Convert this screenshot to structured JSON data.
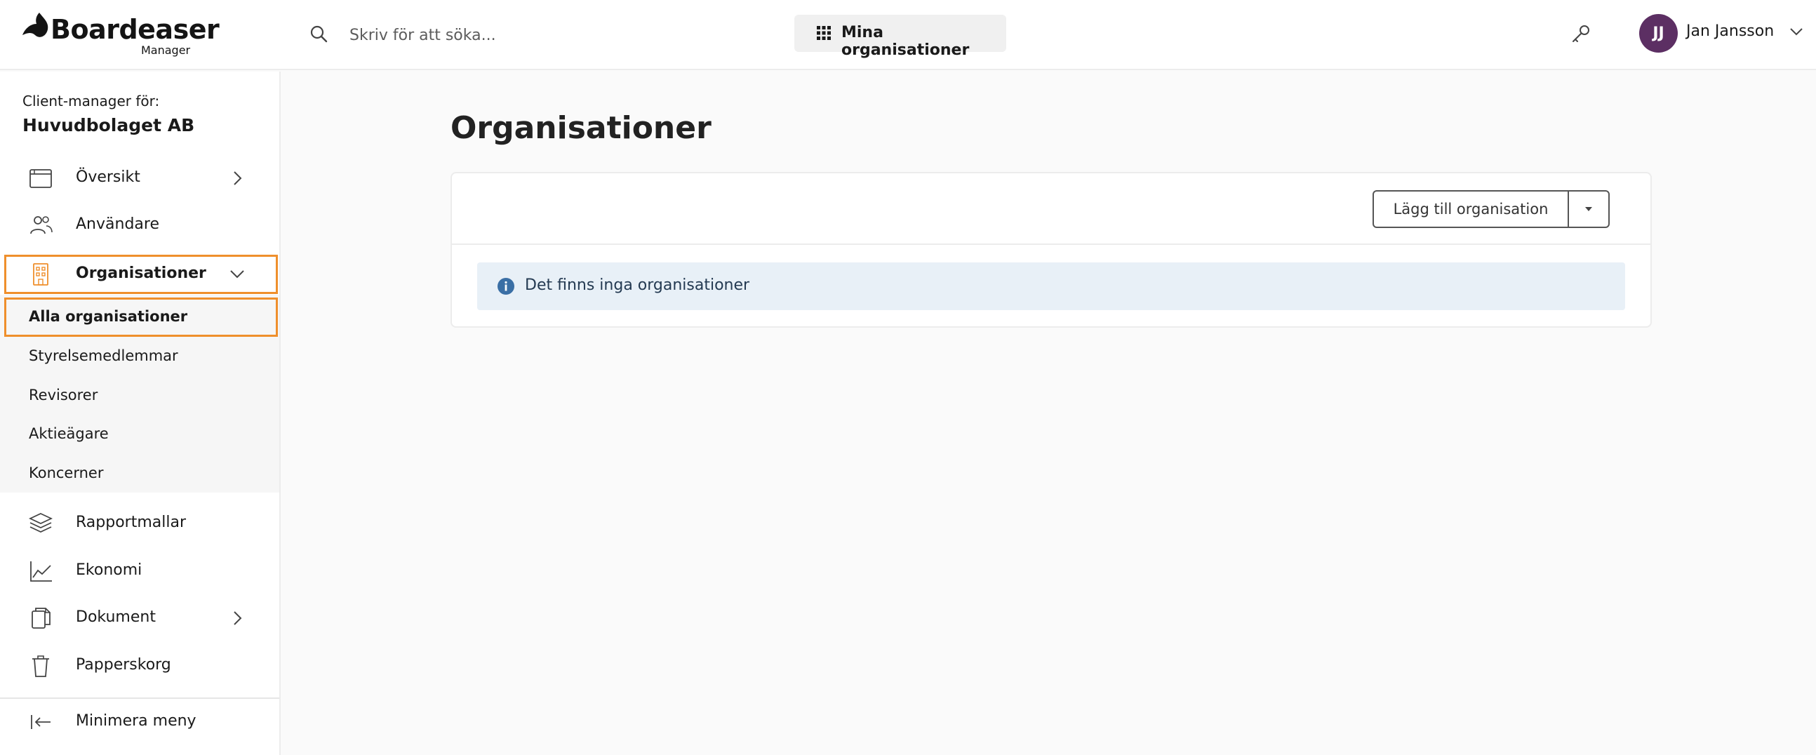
{
  "brand": {
    "name": "Boardeaser",
    "sub": "Manager"
  },
  "header": {
    "search_placeholder": "Skriv för att söka...",
    "my_orgs_label": "Mina organisationer",
    "user_initials": "JJ",
    "user_name": "Jan Jansson"
  },
  "sidebar": {
    "client_label": "Client-manager för:",
    "client_name": "Huvudbolaget AB",
    "items": [
      {
        "label": "Översikt",
        "icon": "calendar-window-icon"
      },
      {
        "label": "Användare",
        "icon": "users-icon"
      },
      {
        "label": "Organisationer",
        "icon": "building-icon"
      },
      {
        "label": "Rapportmallar",
        "icon": "layers-icon"
      },
      {
        "label": "Ekonomi",
        "icon": "line-chart-icon"
      },
      {
        "label": "Dokument",
        "icon": "documents-icon"
      },
      {
        "label": "Papperskorg",
        "icon": "trash-icon"
      }
    ],
    "sub_items": [
      {
        "label": "Alla organisationer"
      },
      {
        "label": "Styrelsemedlemmar"
      },
      {
        "label": "Revisorer"
      },
      {
        "label": "Aktieägare"
      },
      {
        "label": "Koncerner"
      }
    ],
    "minimize_label": "Minimera meny"
  },
  "main": {
    "title": "Organisationer",
    "add_button": "Lägg till organisation",
    "empty_message": "Det finns inga organisationer"
  },
  "colors": {
    "highlight": "#ef8f2c",
    "avatar": "#5c2f63",
    "info_bg": "#e8f0f7",
    "info_icon": "#3a6fa5"
  }
}
